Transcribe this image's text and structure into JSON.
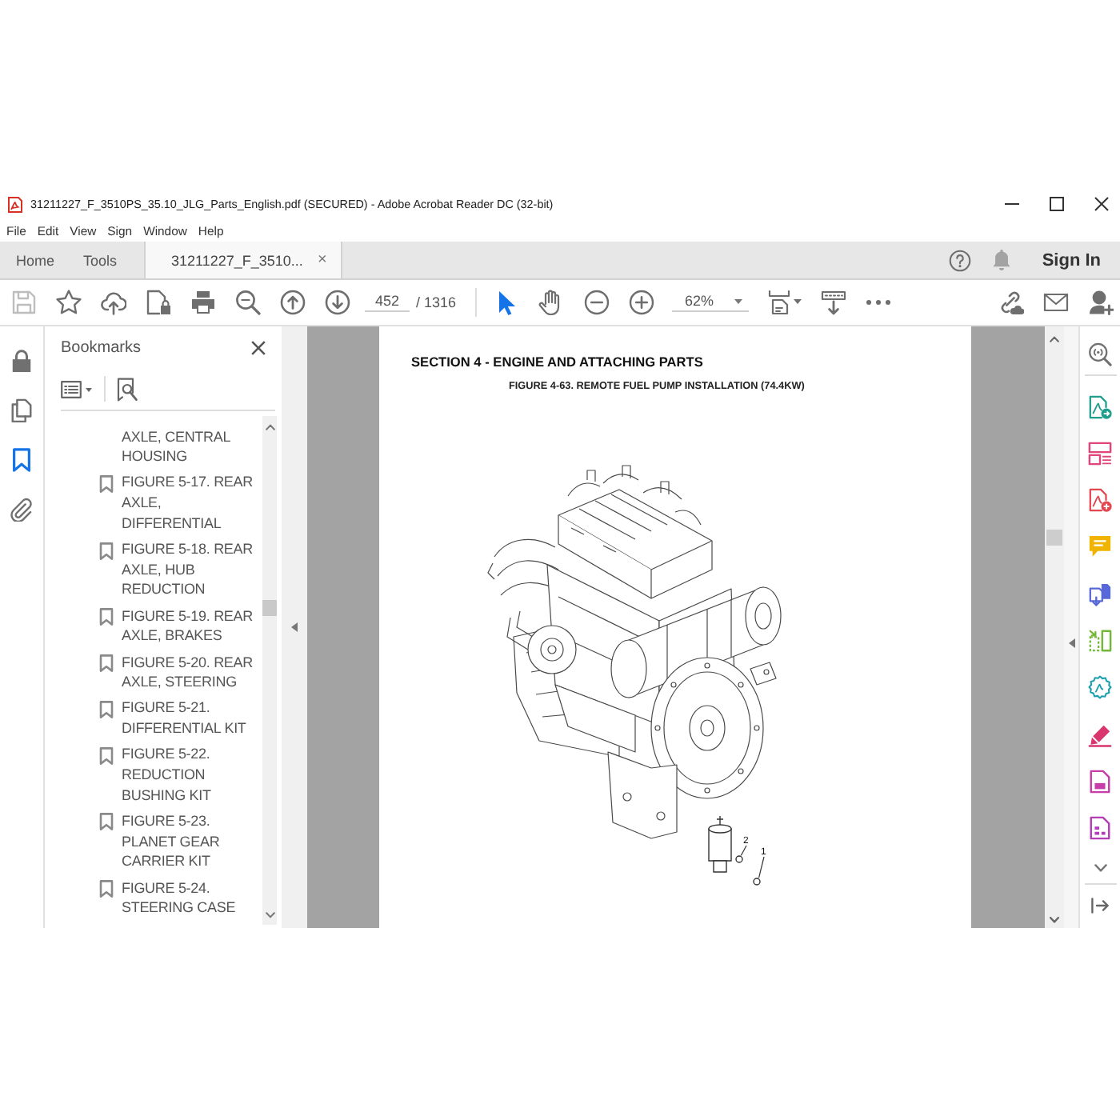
{
  "window": {
    "title": "31211227_F_3510PS_35.10_JLG_Parts_English.pdf (SECURED) - Adobe Acrobat Reader DC (32-bit)"
  },
  "menu": [
    "File",
    "Edit",
    "View",
    "Sign",
    "Window",
    "Help"
  ],
  "tabs": [
    {
      "label": "Home",
      "selected": false
    },
    {
      "label": "Tools",
      "selected": false
    },
    {
      "label": "31211227_F_3510...",
      "selected": true,
      "close": "×"
    }
  ],
  "header": {
    "sign_in": "Sign In"
  },
  "toolbar": {
    "file_tools": [
      {
        "kind": "save",
        "disabled": true
      },
      {
        "kind": "star",
        "disabled": false
      },
      {
        "kind": "upload",
        "disabled": false
      },
      {
        "kind": "protect",
        "disabled": false
      },
      {
        "kind": "print",
        "disabled": false
      },
      {
        "kind": "search",
        "disabled": false
      },
      {
        "kind": "previous",
        "disabled": false
      },
      {
        "kind": "next",
        "disabled": false
      }
    ],
    "page_number": "452",
    "page_count": "/ 1316",
    "pointer_tools": [
      {
        "kind": "select",
        "selected": true
      },
      {
        "kind": "hand",
        "selected": false
      }
    ],
    "zoom_tools": [
      {
        "kind": "zoom_out"
      },
      {
        "kind": "zoom_in"
      }
    ],
    "zoom": "62%",
    "view_tools": [
      {
        "kind": "fit_page"
      },
      {
        "kind": "scroll"
      },
      {
        "kind": "more"
      }
    ],
    "share_tools": [
      {
        "kind": "share_link"
      },
      {
        "kind": "email"
      },
      {
        "kind": "account"
      }
    ]
  },
  "nav_rail": [
    {
      "kind": "lock",
      "selected": false
    },
    {
      "kind": "pages",
      "selected": false
    },
    {
      "kind": "bookmarks",
      "selected": true
    },
    {
      "kind": "attachments",
      "selected": false
    }
  ],
  "bookmarks": {
    "title": "Bookmarks",
    "items": [
      {
        "kind": "continued",
        "label": "AXLE, CENTRAL HOUSING"
      },
      {
        "kind": "bookmark",
        "label": "FIGURE 5-17. REAR AXLE, DIFFERENTIAL"
      },
      {
        "kind": "bookmark",
        "label": "FIGURE 5-18. REAR AXLE, HUB REDUCTION"
      },
      {
        "kind": "bookmark",
        "label": "FIGURE 5-19. REAR AXLE, BRAKES"
      },
      {
        "kind": "bookmark",
        "label": "FIGURE 5-20. REAR AXLE, STEERING"
      },
      {
        "kind": "bookmark",
        "label": "FIGURE 5-21. DIFFERENTIAL KIT"
      },
      {
        "kind": "bookmark",
        "label": "FIGURE 5-22. REDUCTION BUSHING KIT"
      },
      {
        "kind": "bookmark",
        "label": "FIGURE 5-23. PLANET GEAR CARRIER KIT"
      },
      {
        "kind": "bookmark",
        "label": "FIGURE 5-24. STEERING CASE"
      }
    ]
  },
  "document": {
    "heading": "SECTION 4 - ENGINE AND ATTACHING PARTS",
    "caption": "FIGURE 4-63. REMOTE FUEL PUMP INSTALLATION (74.4KW)",
    "callouts": [
      "2",
      "1"
    ]
  },
  "tools_panel": [
    {
      "kind": "enhance"
    },
    {
      "kind": "export"
    },
    {
      "kind": "layout"
    },
    {
      "kind": "create"
    },
    {
      "kind": "comment"
    },
    {
      "kind": "combine"
    },
    {
      "kind": "organize"
    },
    {
      "kind": "scan"
    },
    {
      "kind": "fill_sign"
    },
    {
      "kind": "document"
    },
    {
      "kind": "form"
    }
  ]
}
